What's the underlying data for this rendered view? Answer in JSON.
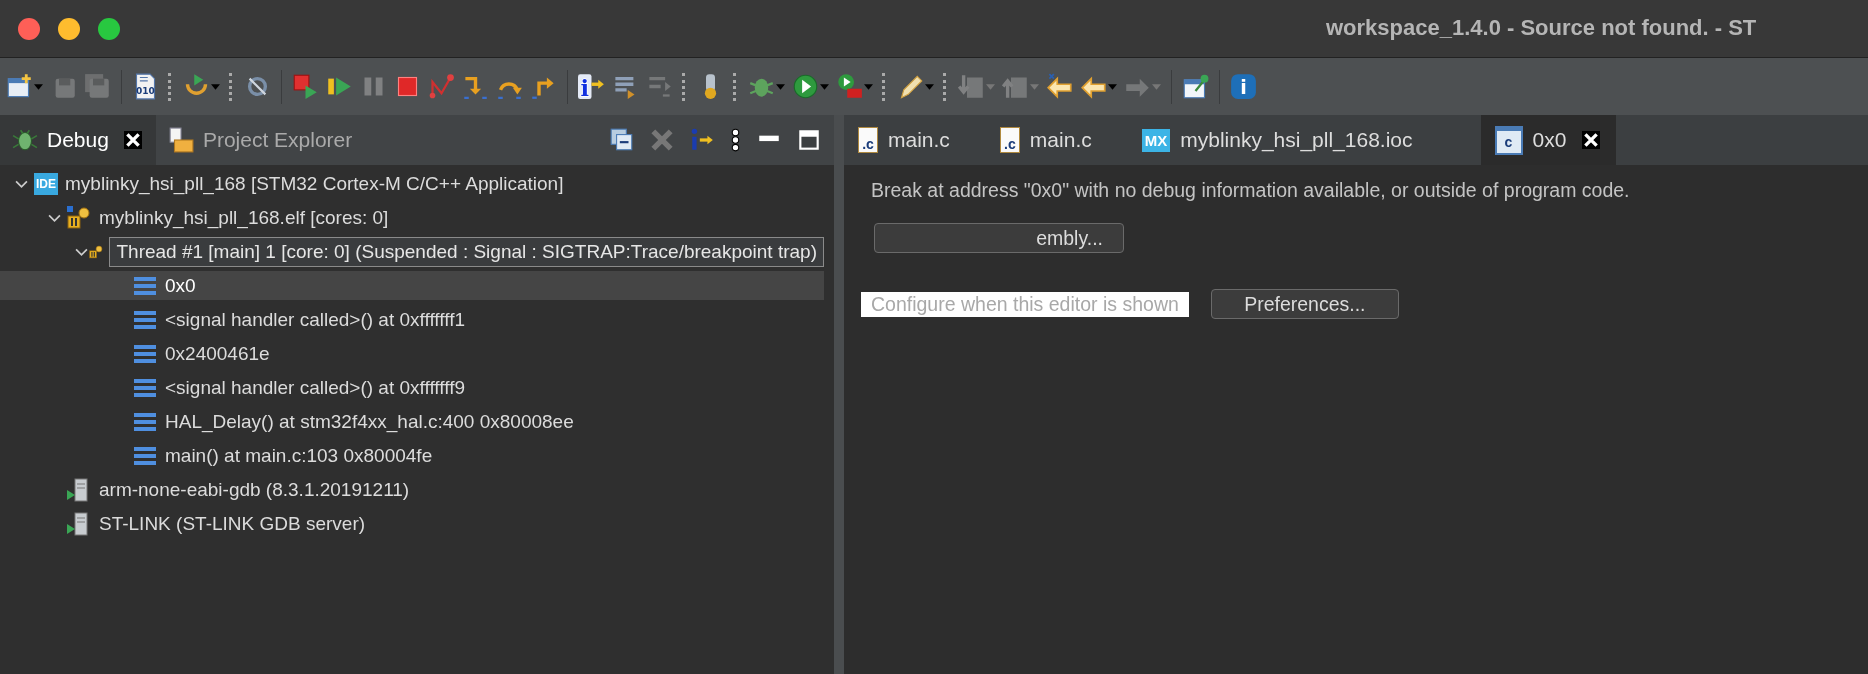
{
  "window": {
    "title": "workspace_1.4.0 - Source not found. - ST"
  },
  "toolbar": [
    {
      "kind": "new",
      "menu": true,
      "disabled": false
    },
    {
      "kind": "save",
      "disabled": true
    },
    {
      "kind": "save-all",
      "disabled": true
    },
    {
      "kind": "separator"
    },
    {
      "kind": "binary",
      "glyph": "010",
      "disabled": false
    },
    {
      "kind": "grip"
    },
    {
      "kind": "connect",
      "menu": true,
      "disabled": false
    },
    {
      "kind": "grip"
    },
    {
      "kind": "skip",
      "disabled": false
    },
    {
      "kind": "separator"
    },
    {
      "kind": "relaunch",
      "disabled": false
    },
    {
      "kind": "resume",
      "disabled": false
    },
    {
      "kind": "suspend",
      "disabled": true
    },
    {
      "kind": "terminate",
      "disabled": false
    },
    {
      "kind": "disconnect",
      "disabled": false
    },
    {
      "kind": "step-into",
      "disabled": false
    },
    {
      "kind": "step-over",
      "disabled": false
    },
    {
      "kind": "step-return",
      "disabled": false
    },
    {
      "kind": "separator"
    },
    {
      "kind": "instruction",
      "glyph": "i",
      "disabled": false
    },
    {
      "kind": "frames",
      "disabled": false
    },
    {
      "kind": "drop",
      "disabled": true
    },
    {
      "kind": "grip"
    },
    {
      "kind": "build",
      "disabled": false
    },
    {
      "kind": "grip"
    },
    {
      "kind": "debug",
      "menu": true,
      "disabled": false
    },
    {
      "kind": "run",
      "menu": true,
      "disabled": false
    },
    {
      "kind": "external",
      "menu": true,
      "disabled": false
    },
    {
      "kind": "grip"
    },
    {
      "kind": "pen",
      "menu": true,
      "disabled": false
    },
    {
      "kind": "grip"
    },
    {
      "kind": "next-annotation",
      "menu": true,
      "disabled": true
    },
    {
      "kind": "prev-annotation",
      "menu": true,
      "disabled": true
    },
    {
      "kind": "last-edit",
      "disabled": false
    },
    {
      "kind": "back",
      "menu": true,
      "disabled": false
    },
    {
      "kind": "forward",
      "menu": true,
      "disabled": true
    },
    {
      "kind": "separator"
    },
    {
      "kind": "pin",
      "disabled": false
    },
    {
      "kind": "separator"
    },
    {
      "kind": "info",
      "glyph": "i",
      "disabled": false
    }
  ],
  "left_panel": {
    "tabs": [
      {
        "kind": "debug",
        "label": "Debug",
        "selected": true,
        "closable": true
      },
      {
        "kind": "explorer",
        "label": "Project Explorer",
        "selected": false,
        "closable": false
      }
    ],
    "tree": [
      {
        "kind": "application",
        "badge": "IDE",
        "label": "myblinky_hsi_pll_168 [STM32 Cortex-M C/C++ Application]",
        "expanded": true,
        "selected": false,
        "children": [
          {
            "kind": "process",
            "label": "myblinky_hsi_pll_168.elf [cores: 0]",
            "expanded": true,
            "selected": false,
            "children": [
              {
                "kind": "thread",
                "label": "Thread #1 [main] 1 [core: 0] (Suspended : Signal : SIGTRAP:Trace/breakpoint trap)",
                "expanded": true,
                "hovered": true,
                "selected": false,
                "children": [
                  {
                    "kind": "frame",
                    "label": "0x0",
                    "selected": true
                  },
                  {
                    "kind": "frame",
                    "label": "<signal handler called>() at 0xfffffff1",
                    "selected": false
                  },
                  {
                    "kind": "frame",
                    "label": "0x2400461e",
                    "selected": false
                  },
                  {
                    "kind": "frame",
                    "label": "<signal handler called>() at 0xfffffff9",
                    "selected": false
                  },
                  {
                    "kind": "frame",
                    "label": "HAL_Delay() at stm32f4xx_hal.c:400 0x80008ee",
                    "selected": false
                  },
                  {
                    "kind": "frame",
                    "label": "main() at main.c:103 0x80004fe",
                    "selected": false
                  }
                ]
              }
            ]
          },
          {
            "kind": "gdb",
            "label": "arm-none-eabi-gdb (8.3.1.20191211)",
            "selected": false
          },
          {
            "kind": "gdb",
            "label": "ST-LINK (ST-LINK GDB server)",
            "selected": false
          }
        ]
      }
    ]
  },
  "editor": {
    "tabs": [
      {
        "kind": "c-source",
        "badge": ".c",
        "label": "main.c",
        "selected": false,
        "closable": false
      },
      {
        "kind": "c-source",
        "badge": ".c",
        "label": "main.c",
        "selected": false,
        "closable": false
      },
      {
        "kind": "cube-mx",
        "badge": "MX",
        "label": "myblinky_hsi_pll_168.ioc",
        "selected": false,
        "closable": false
      },
      {
        "kind": "disassembly",
        "badge": "c",
        "label": "0x0",
        "selected": true,
        "closable": true
      }
    ],
    "message": "Break at address \"0x0\" with no debug information available, or outside of program code.",
    "disassembly_button": "embly...",
    "configure_link": "Configure when this editor is shown",
    "preferences_button": "Preferences..."
  }
}
